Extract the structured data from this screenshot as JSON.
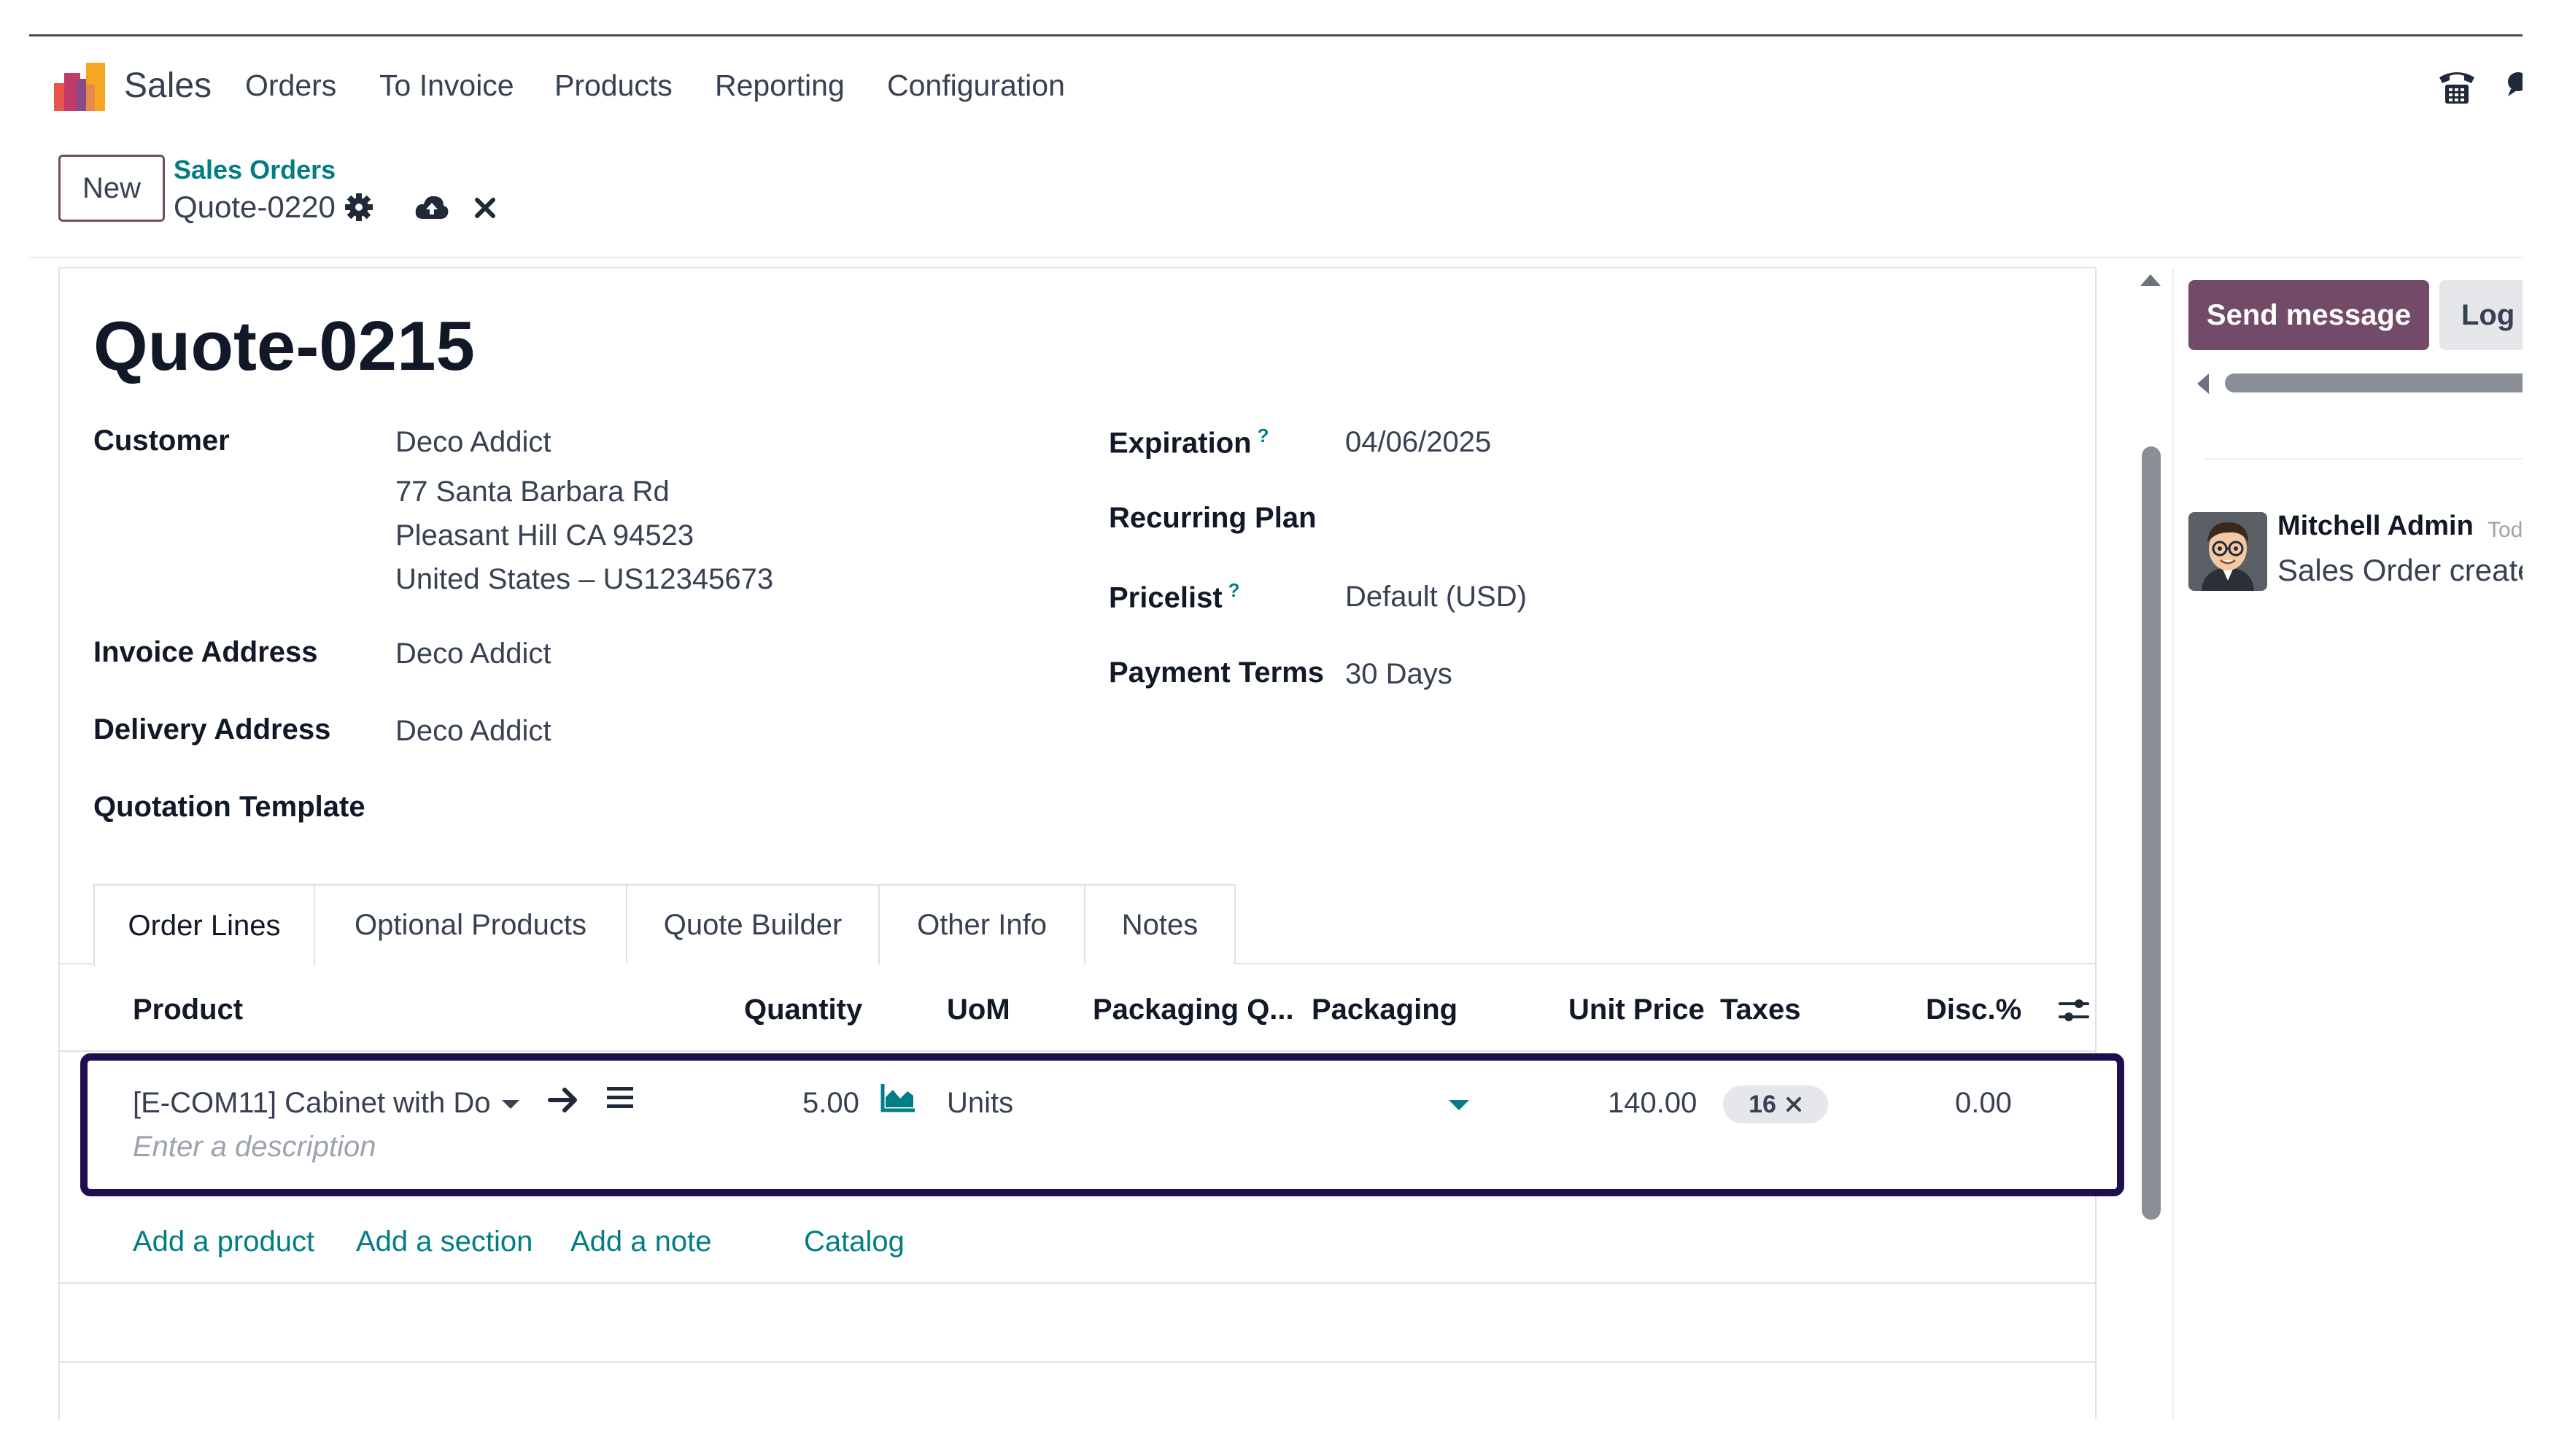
{
  "navbar": {
    "app_name": "Sales",
    "menu": [
      "Orders",
      "To Invoice",
      "Products",
      "Reporting",
      "Configuration"
    ]
  },
  "control_panel": {
    "new_label": "New",
    "breadcrumb_parent": "Sales Orders",
    "breadcrumb_current": "Quote-0220"
  },
  "form": {
    "title": "Quote-0215",
    "left_fields": {
      "customer_label": "Customer",
      "customer_name": "Deco Addict",
      "customer_address_1": "77 Santa Barbara Rd",
      "customer_address_2": "Pleasant Hill CA 94523",
      "customer_address_3": "United States – US12345673",
      "invoice_label": "Invoice Address",
      "invoice_value": "Deco Addict",
      "delivery_label": "Delivery Address",
      "delivery_value": "Deco Addict",
      "template_label": "Quotation Template"
    },
    "right_fields": {
      "expiration_label": "Expiration",
      "expiration_value": "04/06/2025",
      "recurring_label": "Recurring Plan",
      "pricelist_label": "Pricelist",
      "pricelist_value": "Default (USD)",
      "payment_label": "Payment Terms",
      "payment_value": "30 Days",
      "help_mark": "?"
    },
    "tabs": [
      "Order Lines",
      "Optional Products",
      "Quote Builder",
      "Other Info",
      "Notes"
    ],
    "active_tab": "Order Lines"
  },
  "order_lines": {
    "columns": [
      "Product",
      "Quantity",
      "UoM",
      "Packaging Q...",
      "Packaging",
      "Unit Price",
      "Taxes",
      "Disc.%"
    ],
    "row": {
      "product": "[E-COM11] Cabinet with Do",
      "description_placeholder": "Enter a description",
      "quantity": "5.00",
      "uom": "Units",
      "unit_price": "140.00",
      "tax": "16",
      "discount": "0.00"
    },
    "actions": [
      "Add a product",
      "Add a section",
      "Add a note",
      "Catalog"
    ]
  },
  "chatter": {
    "send_label": "Send message",
    "log_label": "Log no",
    "author": "Mitchell Admin",
    "date": "Today a",
    "message": "Sales Order created"
  },
  "colors": {
    "brand": "#714b67",
    "link": "#017e84",
    "highlight_border": "#1f0f4d"
  }
}
